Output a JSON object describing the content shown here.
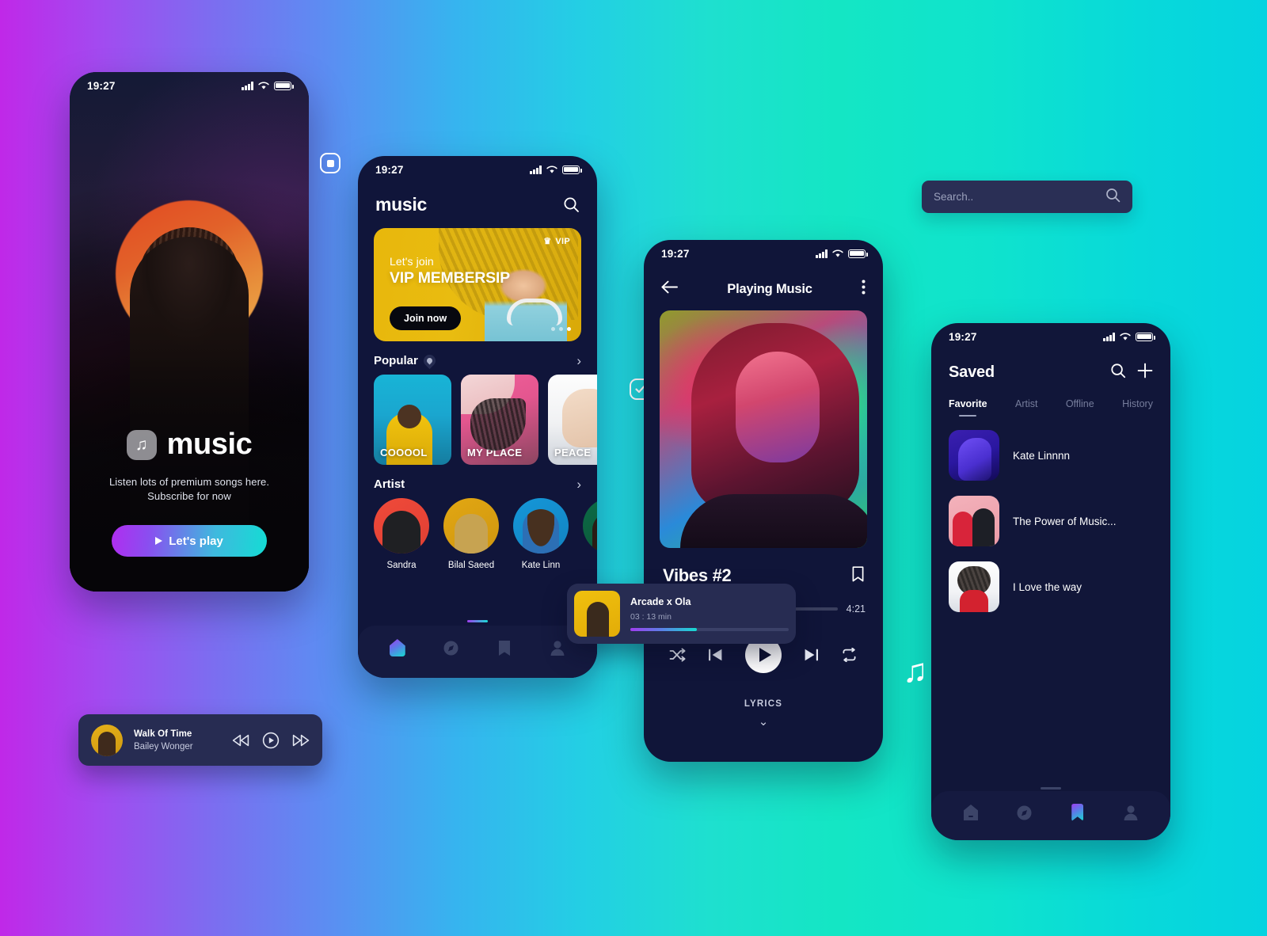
{
  "status_bar": {
    "time": "19:27"
  },
  "splash": {
    "brand": "music",
    "brand_icon": "music-note-icon",
    "subtitle": "Listen lots of premium songs here.\nSubscribe for now",
    "cta_label": "Let's play"
  },
  "home": {
    "title": "music",
    "search_icon": "search-icon",
    "banner": {
      "vip_tag": "VIP",
      "crown_icon": "crown-icon",
      "line1": "Let's join",
      "line2": "VIP MEMBERSIP",
      "button": "Join now",
      "dots": 3,
      "active_dot": 2
    },
    "popular": {
      "title": "Popular",
      "badge_icon": "fire-icon",
      "chevron_icon": "chevron-right-icon",
      "cards": [
        {
          "label": "COOOOL"
        },
        {
          "label": "MY PLACE"
        },
        {
          "label": "PEACE"
        }
      ]
    },
    "artist": {
      "title": "Artist",
      "chevron_icon": "chevron-right-icon",
      "items": [
        {
          "name": "Sandra"
        },
        {
          "name": "Bilal Saeed"
        },
        {
          "name": "Kate Linn"
        },
        {
          "name": ""
        }
      ]
    },
    "tabs": [
      {
        "name": "home-icon",
        "active": true
      },
      {
        "name": "compass-icon",
        "active": false
      },
      {
        "name": "bookmark-icon",
        "active": false
      },
      {
        "name": "profile-icon",
        "active": false
      }
    ]
  },
  "player": {
    "back_icon": "arrow-left-icon",
    "title": "Playing Music",
    "more_icon": "more-vertical-icon",
    "song": "Vibes #2",
    "bookmark_icon": "bookmark-icon",
    "duration": "4:21",
    "progress_percent": 23,
    "controls": {
      "shuffle": "shuffle-icon",
      "previous": "skip-previous-icon",
      "play": "play-icon",
      "next": "skip-next-icon",
      "repeat": "repeat-icon"
    },
    "lyrics_label": "LYRICS",
    "lyrics_chevron": "chevron-down-icon"
  },
  "now_playing_card": {
    "title": "Arcade x Ola",
    "duration": "03 : 13 min",
    "play_icon": "play-circle-icon",
    "progress_percent": 42
  },
  "saved": {
    "title": "Saved",
    "search_icon": "search-icon",
    "add_icon": "plus-icon",
    "tabs": [
      {
        "label": "Favorite",
        "active": true
      },
      {
        "label": "Artist",
        "active": false
      },
      {
        "label": "Offline",
        "active": false
      },
      {
        "label": "History",
        "active": false
      }
    ],
    "items": [
      {
        "name": "Kate Linnnn"
      },
      {
        "name": "The Power of Music..."
      },
      {
        "name": "I Love the way"
      }
    ],
    "tabs_bottom": [
      {
        "name": "home-icon",
        "active": false
      },
      {
        "name": "compass-icon",
        "active": false
      },
      {
        "name": "bookmark-icon",
        "active": true
      },
      {
        "name": "profile-icon",
        "active": false
      }
    ]
  },
  "mini_player": {
    "track": "Walk Of Time",
    "artist": "Bailey Wonger",
    "rewind_icon": "rewind-icon",
    "play_icon": "play-circle-icon",
    "forward_icon": "fast-forward-icon"
  },
  "search": {
    "placeholder": "Search..",
    "icon": "search-icon"
  },
  "decorations": {
    "stop_badge": "stop-square-icon",
    "check_badge": "check-square-icon",
    "music_note": "♫"
  },
  "colors": {
    "bg_start": "#c028e8",
    "bg_mid": "#36b4ef",
    "bg_end": "#05d3e0",
    "panel": "#101533",
    "accent_cyan": "#16dbd0",
    "accent_purple": "#a03df0",
    "vip_yellow": "#e8b70c"
  }
}
